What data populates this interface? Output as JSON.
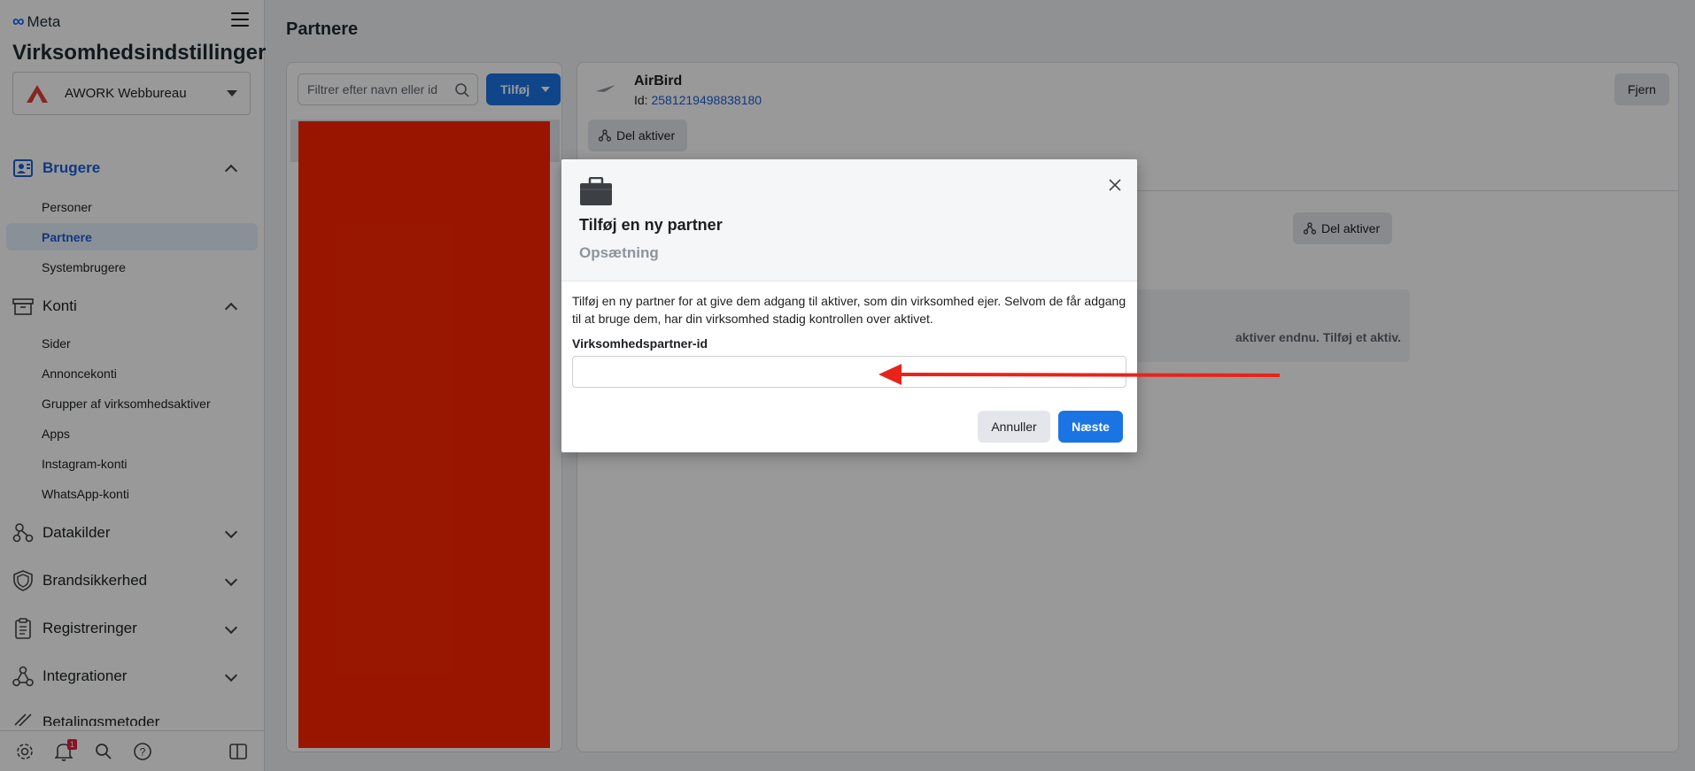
{
  "brand": {
    "logo_text": "Meta"
  },
  "sidebar": {
    "title": "Virksomhedsindstillinger",
    "business": "AWORK Webbureau",
    "sections": [
      {
        "label": "Brugere",
        "items": [
          "Personer",
          "Partnere",
          "Systembrugere"
        ]
      },
      {
        "label": "Konti",
        "items": [
          "Sider",
          "Annoncekonti",
          "Grupper af virksomhedsaktiver",
          "Apps",
          "Instagram-konti",
          "WhatsApp-konti"
        ]
      },
      {
        "label": "Datakilder"
      },
      {
        "label": "Brandsikkerhed"
      },
      {
        "label": "Registreringer"
      },
      {
        "label": "Integrationer"
      },
      {
        "label": "Betalingsmetoder"
      }
    ],
    "active_item": "Partnere",
    "footer": {
      "notification_count": "1"
    }
  },
  "main": {
    "title": "Partnere",
    "search_placeholder": "Filtrer efter navn eller id",
    "add_label": "Tilføj",
    "partner": {
      "name": "AirBird",
      "id_prefix": "Id: ",
      "id": "2581219498838180",
      "remove_label": "Fjern",
      "share_label": "Del aktiver"
    },
    "share_label_2": "Del aktiver",
    "empty_text": "aktiver endnu. Tilføj et aktiv."
  },
  "dialog": {
    "title": "Tilføj en ny partner",
    "subtitle": "Opsætning",
    "description": "Tilføj en ny partner for at give dem adgang til aktiver, som din virksomhed ejer. Selvom de får adgang til at bruge dem, har din virksomhed stadig kontrollen over aktivet.",
    "field_label": "Virksomhedspartner-id",
    "field_value": "",
    "cancel_label": "Annuller",
    "next_label": "Næste"
  },
  "colors": {
    "accent": "#1b74e4",
    "active_text": "#1a5fd6",
    "redaction": "#ff2400",
    "arrow": "#e8231a"
  }
}
